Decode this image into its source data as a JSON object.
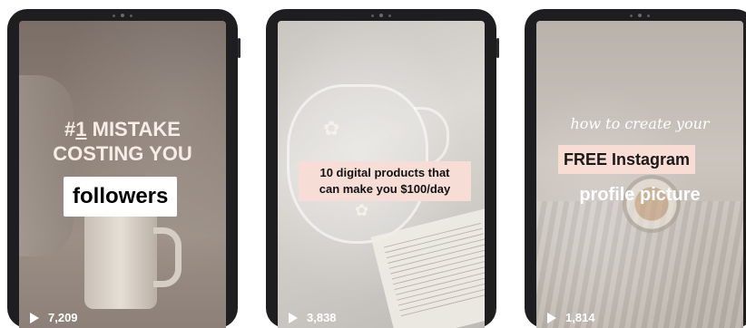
{
  "posts": [
    {
      "headline_line1_prefix": "#",
      "headline_line1_hash": "1",
      "headline_line1_rest": " MISTAKE",
      "headline_line2": "COSTING YOU",
      "highlight": "followers",
      "views": "7,209"
    },
    {
      "line1": "10 digital products that",
      "line2": "can make you $100/day",
      "views": "3,838"
    },
    {
      "script": "how to create your",
      "highlight": "FREE Instagram",
      "subtitle": "profile picture",
      "views": "1,814"
    }
  ],
  "colors": {
    "device_frame": "#1e1e21",
    "pink_label": "#f6ddd5",
    "headline_text": "#f7ece6"
  },
  "icons": {
    "play": "play-icon"
  }
}
